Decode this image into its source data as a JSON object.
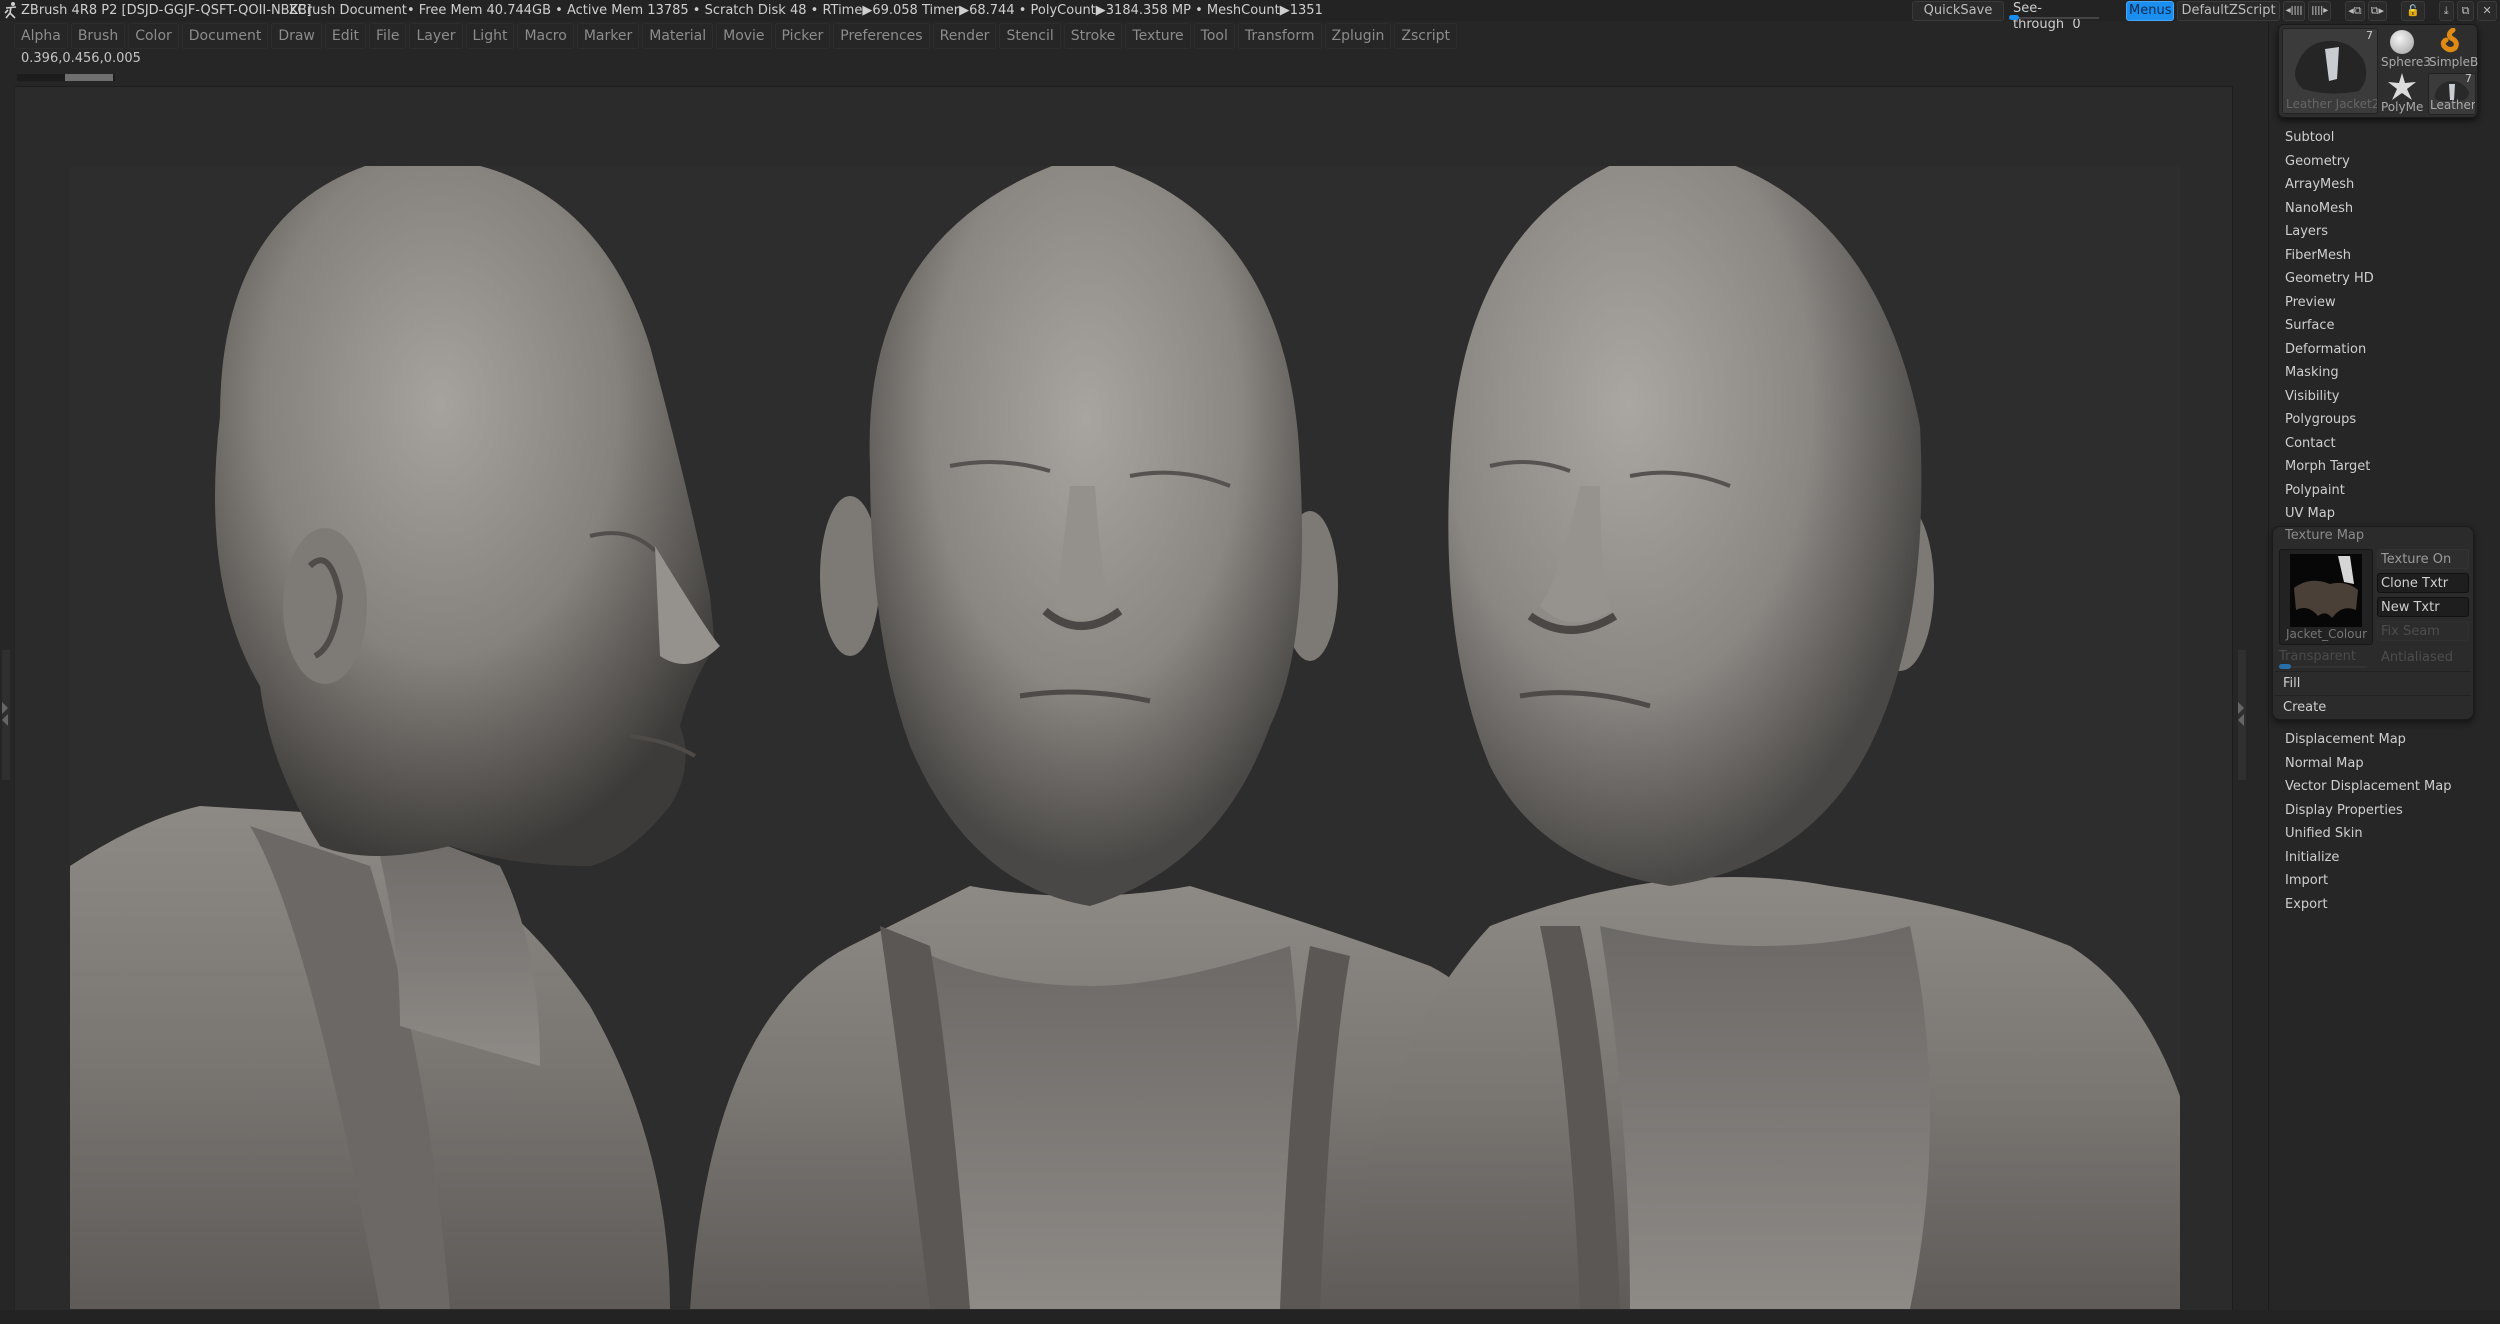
{
  "titlebar": {
    "app_title": "ZBrush 4R8 P2 [DSJD-GGJF-QSFT-QOII-NBKC]",
    "document": "ZBrush Document",
    "stats": "• Free Mem 40.744GB • Active Mem 13785 • Scratch Disk 48 •  RTime▶69.058 Timer▶68.744 • PolyCount▶3184.358 MP  • MeshCount▶1351"
  },
  "menubar": {
    "items": [
      "Alpha",
      "Brush",
      "Color",
      "Document",
      "Draw",
      "Edit",
      "File",
      "Layer",
      "Light",
      "Macro",
      "Marker",
      "Material",
      "Movie",
      "Picker",
      "Preferences",
      "Render",
      "Stencil",
      "Stroke",
      "Texture",
      "Tool",
      "Transform",
      "Zplugin",
      "Zscript"
    ]
  },
  "coordinates": "0.396,0.456,0.005",
  "topright": {
    "quicksave": "QuickSave",
    "see_through_label": "See-through",
    "see_through_value": "0",
    "menus": "Menus",
    "default_zscript": "DefaultZScript",
    "icons": [
      "◂ǀǀǀǀ",
      "ǀǀǀǀ▸",
      "◂⧉",
      "⧉▸",
      "🔓",
      "⤓",
      "⧉",
      "✕"
    ],
    "accent": "#1a8ff0"
  },
  "tool_palette": {
    "current": {
      "label": "Leather Jacket2",
      "count": "7"
    },
    "tools": [
      {
        "label": "Sphere3"
      },
      {
        "label": "SimpleB"
      },
      {
        "label": "PolyMe"
      },
      {
        "label": "Leather",
        "count": "7"
      }
    ]
  },
  "tool_subpalettes_top": [
    "Subtool",
    "Geometry",
    "ArrayMesh",
    "NanoMesh",
    "Layers",
    "FiberMesh",
    "Geometry HD",
    "Preview",
    "Surface",
    "Deformation",
    "Masking",
    "Visibility",
    "Polygroups",
    "Contact",
    "Morph Target",
    "Polypaint",
    "UV Map"
  ],
  "texture_map": {
    "title": "Texture Map",
    "texture_name": "Jacket_Colour",
    "texture_on": "Texture On",
    "clone_txtr": "Clone Txtr",
    "new_txtr": "New Txtr",
    "fix_seam": "Fix Seam",
    "transparent": "Transparent",
    "antialiased": "Antialiased",
    "fill": "Fill",
    "create": "Create"
  },
  "tool_subpalettes_bottom": [
    "Displacement Map",
    "Normal Map",
    "Vector Displacement Map",
    "Display Properties",
    "Unified Skin",
    "Initialize",
    "Import",
    "Export"
  ],
  "canvas": {
    "subject": "Three views of sculpted bald male head wearing leather jacket"
  }
}
